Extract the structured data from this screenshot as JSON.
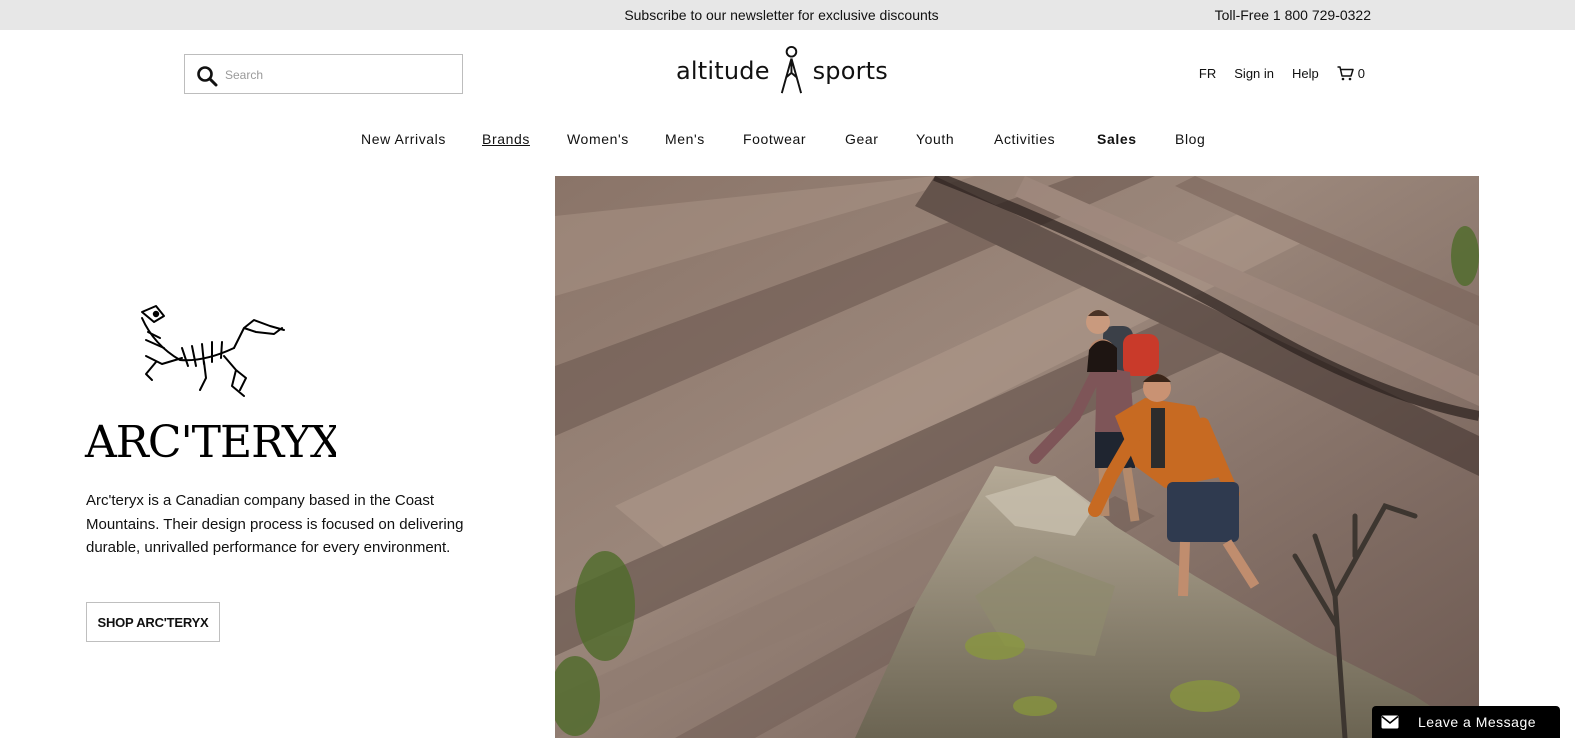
{
  "promo": {
    "message": "Subscribe to our newsletter for exclusive discounts",
    "phone": "Toll-Free 1 800 729-0322"
  },
  "search": {
    "placeholder": "Search",
    "value": ""
  },
  "logo": {
    "word_left": "altitude",
    "word_right": "sports"
  },
  "utility_nav": {
    "language": "FR",
    "sign_in": "Sign in",
    "help": "Help",
    "cart_count": "0"
  },
  "main_nav": {
    "items": [
      {
        "label": "New Arrivals"
      },
      {
        "label": "Brands"
      },
      {
        "label": "Women's"
      },
      {
        "label": "Men's"
      },
      {
        "label": "Footwear"
      },
      {
        "label": "Gear"
      },
      {
        "label": "Youth"
      },
      {
        "label": "Activities"
      },
      {
        "label": "Sales"
      },
      {
        "label": "Blog"
      }
    ]
  },
  "brand": {
    "logo_text": "ARC'TERYX",
    "description": "Arc'teryx is a Canadian company based in the Coast Mountains. Their design process is focused on delivering durable, unrivalled performance for every environment.",
    "shop_label": "SHOP ARC'TERYX"
  },
  "chat": {
    "label": "Leave a Message"
  },
  "colors": {
    "promo_bg": "#e7e7e7",
    "text": "#111111",
    "chat_bg": "#000000"
  }
}
